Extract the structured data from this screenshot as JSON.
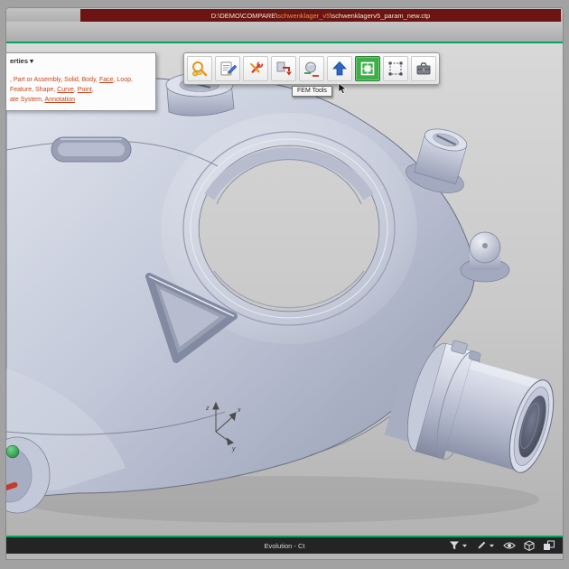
{
  "window": {
    "title_prefix": "D:\\DEMO\\COMPARE\\",
    "title_highlight": "schwenklager_v5",
    "title_suffix": "\\schwenklagerv5_param_new.ctp"
  },
  "selection_panel": {
    "header_label": "erties",
    "header_arrow": "▾",
    "lines": [
      {
        "seg1": ", Part or Assembly, Solid, Body, ",
        "link1": "Face",
        "seg2": ", Loop,"
      },
      {
        "seg1": " Feature, Shape, ",
        "link1": "Curve",
        "seg2": ", ",
        "link2": "Point",
        "seg3": ","
      },
      {
        "seg1": "ate System, ",
        "link1": "Annotation"
      }
    ]
  },
  "toolbar": {
    "tooltip": "FEM Tools",
    "active_button": "fem-tools",
    "buttons": [
      "zoom-key",
      "annotate",
      "repair-tools",
      "template-export",
      "compare-solids",
      "publish-up",
      "fem-tools",
      "transform-select",
      "toolbox"
    ]
  },
  "icons": {
    "toolbar": [
      "magnifier-key",
      "pencil-note",
      "wrench-screwdriver",
      "export-red-arrow",
      "compare-sphere",
      "blue-up-arrow",
      "fem-mesh",
      "selection-handles",
      "toolbox-case"
    ],
    "statusbar": [
      "filter-funnel",
      "caret-down",
      "probe-pencil",
      "caret-down",
      "eye",
      "view-cube",
      "cube-stack"
    ]
  },
  "axes": {
    "x": "x",
    "y": "y",
    "z": "z"
  },
  "statusbar": {
    "label": "Evolution - Ct"
  },
  "colors": {
    "titlebar": "#6b1413",
    "accent_green": "#00a65d",
    "active_button_green": "#3fae49",
    "link_orange": "#c8441c",
    "model_base": "#c3c9d9"
  }
}
